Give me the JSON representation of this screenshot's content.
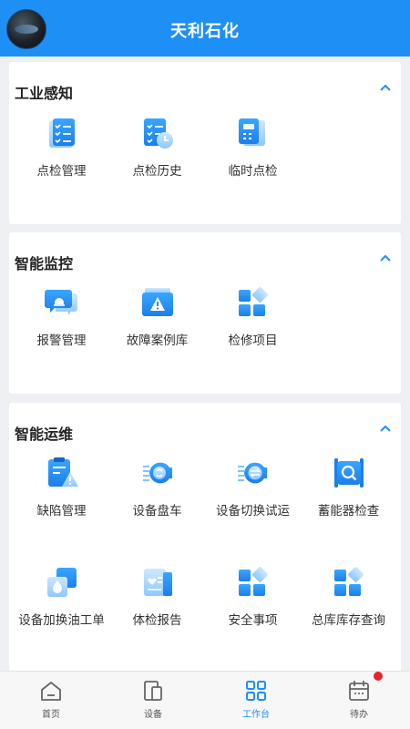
{
  "header": {
    "title": "天利石化"
  },
  "sections": [
    {
      "title": "工业感知",
      "items": [
        {
          "label": "点检管理",
          "icon": "checklist-icon"
        },
        {
          "label": "点检历史",
          "icon": "checklist-history-icon"
        },
        {
          "label": "临时点检",
          "icon": "temporary-check-icon"
        }
      ]
    },
    {
      "title": "智能监控",
      "items": [
        {
          "label": "报警管理",
          "icon": "alarm-message-icon"
        },
        {
          "label": "故障案例库",
          "icon": "fault-warning-icon"
        },
        {
          "label": "检修项目",
          "icon": "blocks-icon"
        }
      ]
    },
    {
      "title": "智能运维",
      "items": [
        {
          "label": "缺陷管理",
          "icon": "defect-clipboard-icon"
        },
        {
          "label": "设备盘车",
          "icon": "rotation-gear-icon"
        },
        {
          "label": "设备切换试运",
          "icon": "switch-arrows-icon"
        },
        {
          "label": "蓄能器检查",
          "icon": "accumulator-search-icon"
        },
        {
          "label": "设备加换油工单",
          "icon": "oil-drop-icon"
        },
        {
          "label": "体检报告",
          "icon": "health-report-icon"
        },
        {
          "label": "安全事项",
          "icon": "safety-blocks-icon"
        },
        {
          "label": "总库库存查询",
          "icon": "inventory-blocks-icon"
        }
      ]
    }
  ],
  "tabbar": [
    {
      "label": "首页",
      "icon": "home-icon"
    },
    {
      "label": "设备",
      "icon": "device-icon"
    },
    {
      "label": "工作台",
      "icon": "grid-icon",
      "active": true
    },
    {
      "label": "待办",
      "icon": "calendar-icon",
      "badge": true
    }
  ],
  "colors": {
    "accent": "#1e90f5",
    "light_accent": "#7ec3ff",
    "badge": "#e8232a"
  }
}
